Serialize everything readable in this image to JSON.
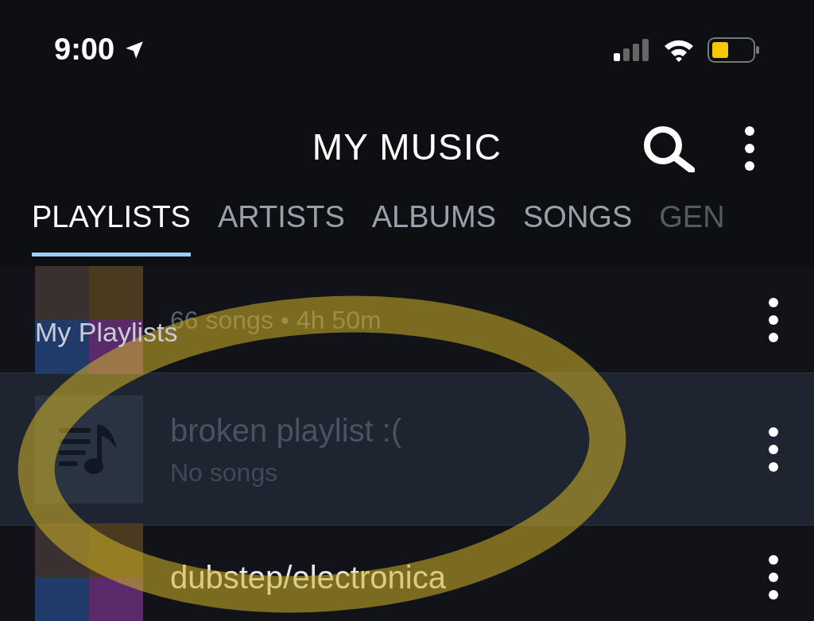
{
  "status_bar": {
    "time": "9:00"
  },
  "header": {
    "title": "MY MUSIC"
  },
  "tabs": [
    {
      "label": "PLAYLISTS",
      "selected": true
    },
    {
      "label": "ARTISTS",
      "selected": false
    },
    {
      "label": "ALBUMS",
      "selected": false
    },
    {
      "label": "SONGS",
      "selected": false
    },
    {
      "label": "GEN",
      "selected": false
    }
  ],
  "section": {
    "title": "My Playlists"
  },
  "playlists": [
    {
      "kind": "collage",
      "subtitle": "66 songs • 4h 50m",
      "selected": false
    },
    {
      "kind": "empty",
      "title": "broken playlist :(",
      "subtitle": "No songs",
      "selected": true
    },
    {
      "kind": "collage",
      "title": "dubstep/electronica",
      "selected": false
    }
  ]
}
